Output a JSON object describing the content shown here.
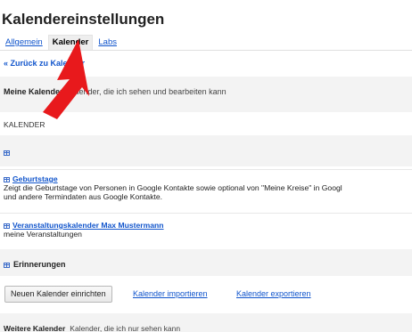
{
  "page": {
    "title": "Kalendereinstellungen"
  },
  "tabs": [
    {
      "label": "Allgemein",
      "active": false
    },
    {
      "label": "Kalender",
      "active": true
    },
    {
      "label": "Labs",
      "active": false
    }
  ],
  "back_link": "« Zurück zu Kalender",
  "my_calendars": {
    "title": "Meine Kalender",
    "description": "Kalender, die ich sehen und bearbeiten kann"
  },
  "column_header": "KALENDER",
  "calendars": [
    {
      "name": "Geburtstage",
      "description_line1": "Zeigt die Geburtstage von Personen in Google Kontakte sowie optional von \"Meine Kreise\" in Googl",
      "description_line2": "und andere Termindaten aus Google Kontakte."
    },
    {
      "name": "Veranstaltungskalender Max Mustermann",
      "description_line1": "meine Veranstaltungen"
    }
  ],
  "reminders": {
    "label": "Erinnerungen"
  },
  "actions": {
    "new_calendar": "Neuen Kalender einrichten",
    "import_calendar": "Kalender importieren",
    "export_calendar": "Kalender exportieren"
  },
  "other_calendars": {
    "title": "Weitere Kalender",
    "description": "Kalender, die ich nur sehen kann"
  },
  "colors": {
    "link": "#1155cc",
    "active_tab_bg": "#eeeeee",
    "band_bg": "#f3f3f3",
    "annotation_arrow": "#e8191c"
  },
  "icons": {
    "calendar": "calendar-grid-icon",
    "annotation": "red-arrow-annotation"
  }
}
